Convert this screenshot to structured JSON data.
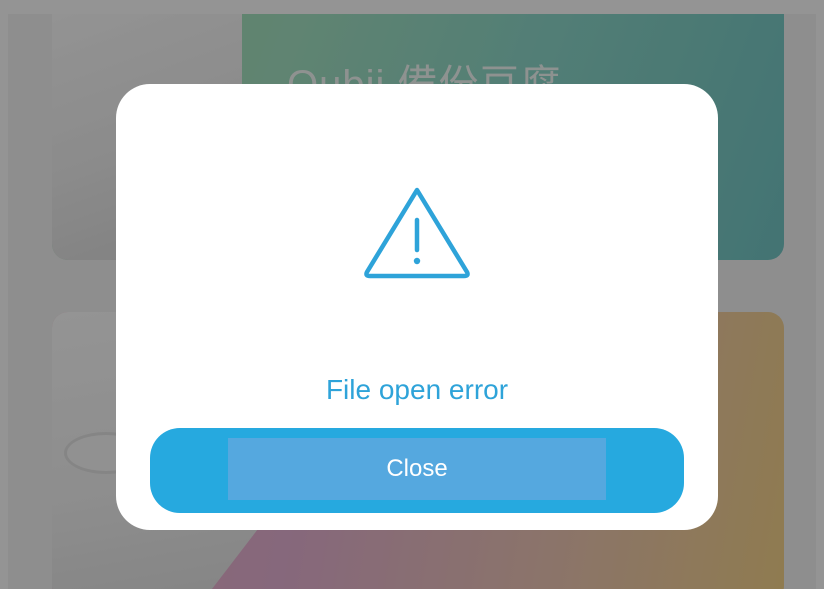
{
  "background": {
    "top_card_title": "Qubii 備份豆腐"
  },
  "dialog": {
    "icon": "warning-triangle-icon",
    "message": "File open error",
    "close_label": "Close",
    "accent_color": "#2ea3d9",
    "button_color": "#26a9df"
  }
}
